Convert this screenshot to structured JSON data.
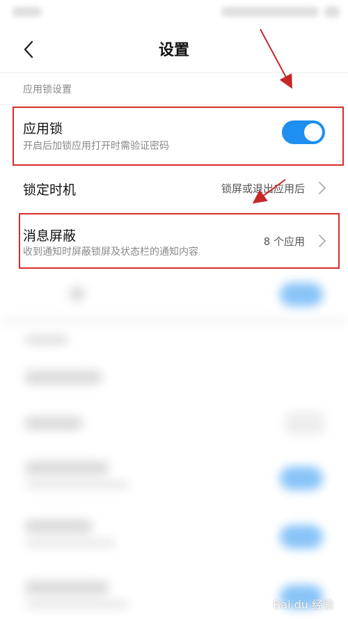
{
  "header": {
    "title": "设置"
  },
  "section": {
    "label": "应用锁设置"
  },
  "items": [
    {
      "title": "应用锁",
      "subtitle": "开启后加锁应用打开时需验证密码",
      "toggle_on": true
    },
    {
      "title": "锁定时机",
      "value": "锁屏或退出应用后"
    },
    {
      "title": "消息屏蔽",
      "subtitle": "收到通知时屏蔽锁屏及状态栏的通知内容",
      "value": "8 个应用"
    }
  ],
  "colors": {
    "accent": "#1e8ff0",
    "highlight": "#d72b2b",
    "arrow": "#c62828"
  },
  "icons": {
    "back": "chevron-left-icon",
    "item": "chevron-right-icon"
  },
  "watermark": "Bai du 经验"
}
